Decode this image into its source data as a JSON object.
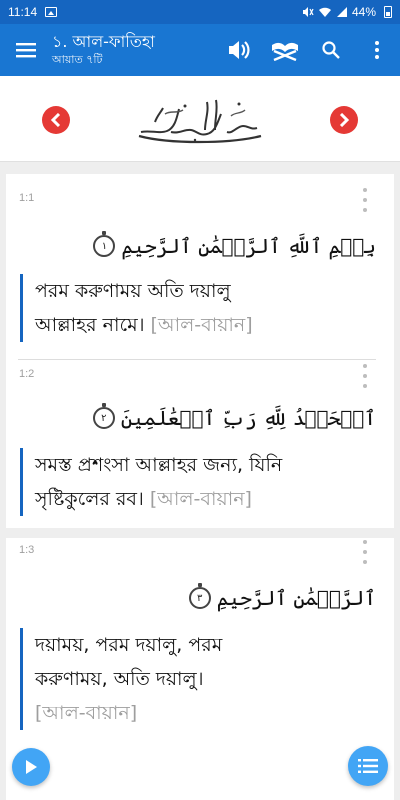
{
  "status_bar": {
    "time": "11:14",
    "battery_percent": "44%",
    "icons": [
      "image-icon",
      "mute-icon",
      "wifi-icon",
      "signal-icon",
      "battery-icon"
    ]
  },
  "app_bar": {
    "title": "১. আল-ফাতিহা",
    "subtitle": "আয়াত ৭টি",
    "icons": [
      "menu-icon",
      "audio-icon",
      "quran-stand-icon",
      "search-icon",
      "more-vert-icon"
    ]
  },
  "header": {
    "prev_icon": "chevron-left-icon",
    "next_icon": "chevron-right-icon",
    "bismillah_calligraphy": "بِسْمِ اللَّهِ الرَّحْمَٰنِ الرَّحِيمِ"
  },
  "verses": [
    {
      "number": "1:1",
      "arabic": "بِسۡمِ ٱللَّهِ ٱلرَّحۡمَٰنِ ٱلرَّحِيمِ",
      "ayah_mark": "١",
      "translation_line1": "পরম করুণাময় অতি দয়ালু",
      "translation_line2": "আল্লাহর নামে।",
      "source": "[আল-বায়ান]"
    },
    {
      "number": "1:2",
      "arabic": "ٱلۡحَمۡدُ لِلَّهِ رَبِّ ٱلۡعَٰلَمِينَ",
      "ayah_mark": "٢",
      "translation_line1": "সমস্ত প্রশংসা আল্লাহর জন্য, যিনি",
      "translation_line2": "সৃষ্টিকুলের রব।",
      "source": "[আল-বায়ান]"
    },
    {
      "number": "1:3",
      "arabic": "ٱلرَّحۡمَٰنِ ٱلرَّحِيمِ",
      "ayah_mark": "٣",
      "translation_line1": "দয়াময়, পরম দয়ালু, পরম",
      "translation_line2": "করুণাময়, অতি দয়ালু।",
      "source": "[আল-বায়ান]"
    }
  ],
  "fabs": {
    "play_icon": "play-icon",
    "list_icon": "list-icon"
  },
  "colors": {
    "status_bar": "#1565c0",
    "app_bar": "#1976d2",
    "nav_button": "#e53935",
    "accent_border": "#1565c0",
    "fab": "#42a5f5",
    "source_text": "#9e9e9e"
  }
}
